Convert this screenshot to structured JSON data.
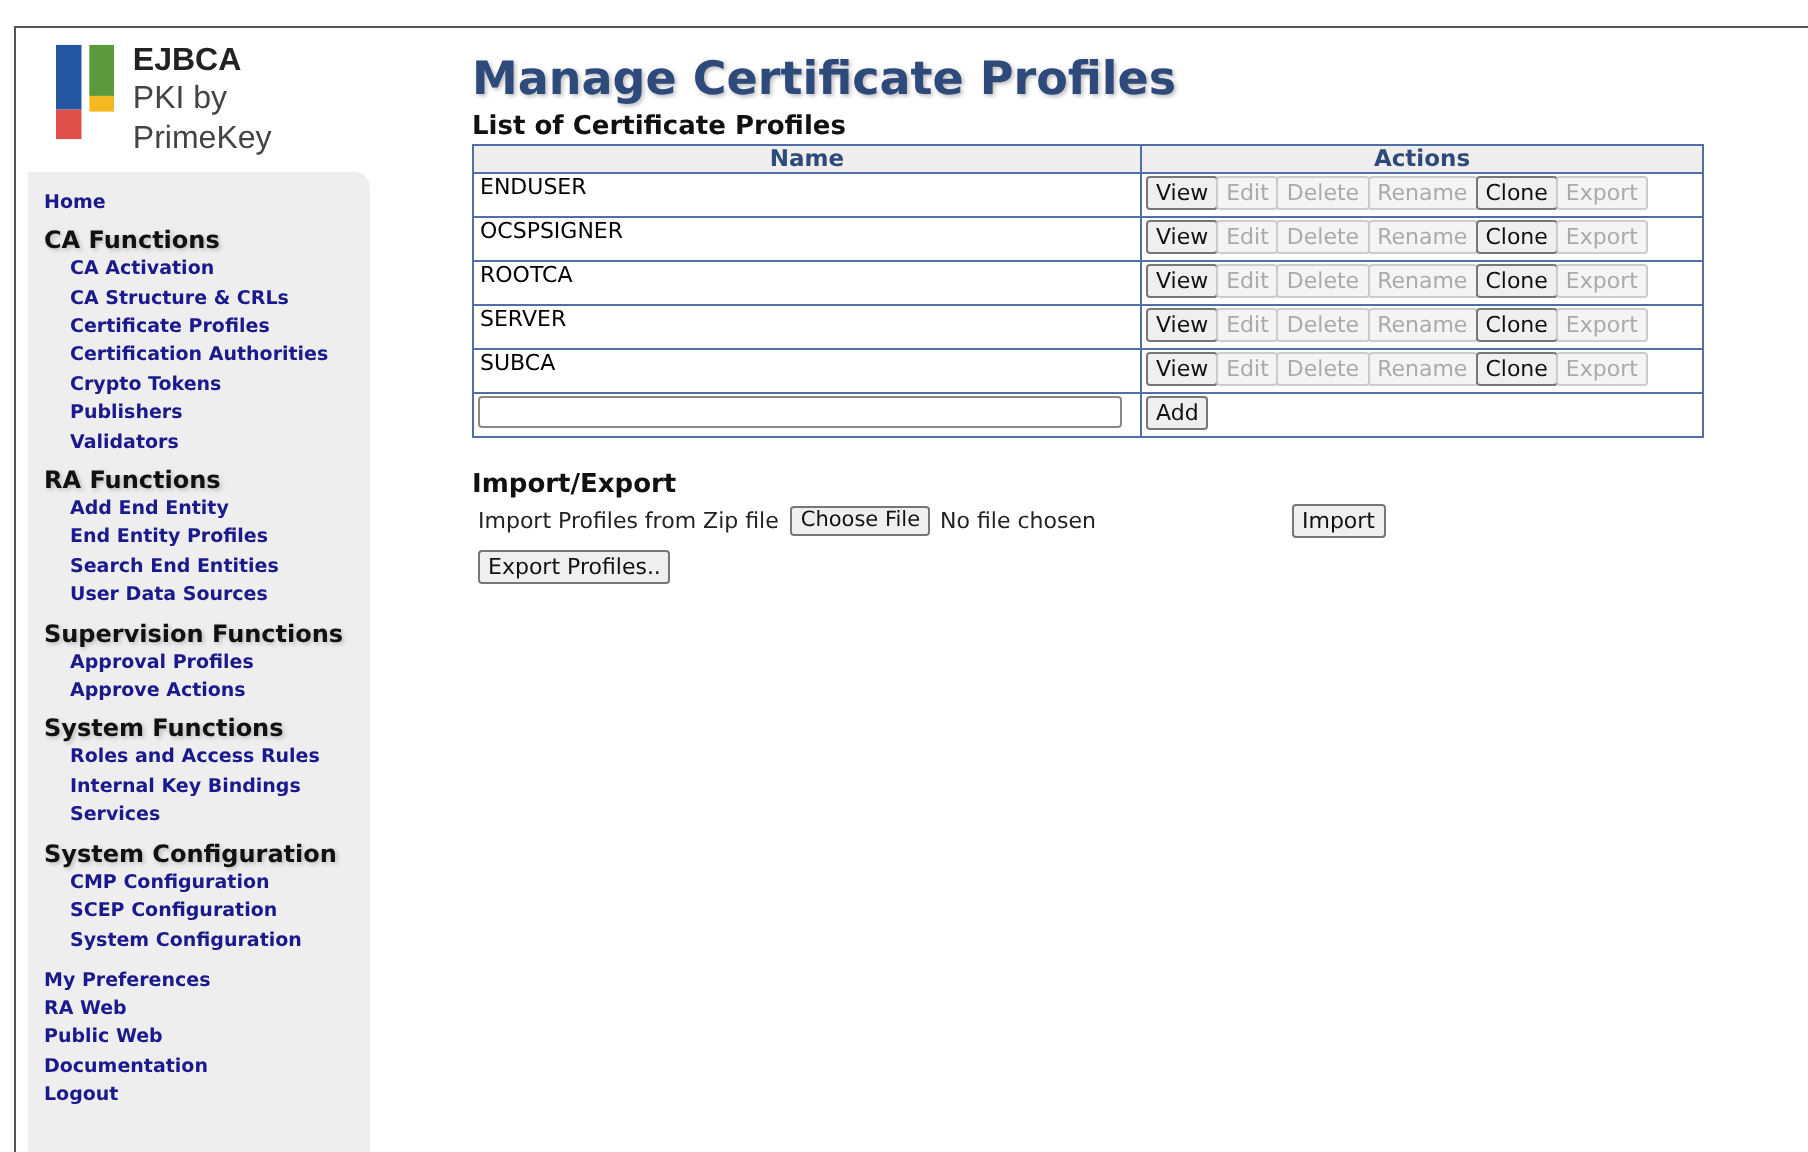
{
  "logo": {
    "title": "EJBCA",
    "subtitle": "PKI by PrimeKey"
  },
  "sidebar": {
    "top": [
      {
        "label": "Home"
      }
    ],
    "sections": [
      {
        "heading": "CA Functions",
        "items": [
          {
            "label": "CA Activation"
          },
          {
            "label": "CA Structure & CRLs"
          },
          {
            "label": "Certificate Profiles"
          },
          {
            "label": "Certification Authorities"
          },
          {
            "label": "Crypto Tokens"
          },
          {
            "label": "Publishers"
          },
          {
            "label": "Validators"
          }
        ]
      },
      {
        "heading": "RA Functions",
        "items": [
          {
            "label": "Add End Entity"
          },
          {
            "label": "End Entity Profiles"
          },
          {
            "label": "Search End Entities"
          },
          {
            "label": "User Data Sources"
          }
        ]
      },
      {
        "heading": "Supervision Functions",
        "items": [
          {
            "label": "Approval Profiles"
          },
          {
            "label": "Approve Actions"
          }
        ]
      },
      {
        "heading": "System Functions",
        "items": [
          {
            "label": "Roles and Access Rules"
          },
          {
            "label": "Internal Key Bindings"
          },
          {
            "label": "Services"
          }
        ]
      },
      {
        "heading": "System Configuration",
        "items": [
          {
            "label": "CMP Configuration"
          },
          {
            "label": "SCEP Configuration"
          },
          {
            "label": "System Configuration"
          }
        ]
      }
    ],
    "bottom": [
      {
        "label": "My Preferences"
      },
      {
        "label": "RA Web"
      },
      {
        "label": "Public Web"
      },
      {
        "label": "Documentation"
      },
      {
        "label": "Logout"
      }
    ]
  },
  "page_title": "Manage Certificate Profiles",
  "table": {
    "title": "List of Certificate Profiles",
    "columns": [
      "Name",
      "Actions"
    ],
    "rows": [
      {
        "name": "ENDUSER",
        "actions": [
          {
            "label": "View",
            "disabled": false
          },
          {
            "label": "Edit",
            "disabled": true
          },
          {
            "label": "Delete",
            "disabled": true
          },
          {
            "label": "Rename",
            "disabled": true
          },
          {
            "label": "Clone",
            "disabled": false
          },
          {
            "label": "Export",
            "disabled": true
          }
        ]
      },
      {
        "name": "OCSPSIGNER",
        "actions": [
          {
            "label": "View",
            "disabled": false
          },
          {
            "label": "Edit",
            "disabled": true
          },
          {
            "label": "Delete",
            "disabled": true
          },
          {
            "label": "Rename",
            "disabled": true
          },
          {
            "label": "Clone",
            "disabled": false
          },
          {
            "label": "Export",
            "disabled": true
          }
        ]
      },
      {
        "name": "ROOTCA",
        "actions": [
          {
            "label": "View",
            "disabled": false
          },
          {
            "label": "Edit",
            "disabled": true
          },
          {
            "label": "Delete",
            "disabled": true
          },
          {
            "label": "Rename",
            "disabled": true
          },
          {
            "label": "Clone",
            "disabled": false
          },
          {
            "label": "Export",
            "disabled": true
          }
        ]
      },
      {
        "name": "SERVER",
        "actions": [
          {
            "label": "View",
            "disabled": false
          },
          {
            "label": "Edit",
            "disabled": true
          },
          {
            "label": "Delete",
            "disabled": true
          },
          {
            "label": "Rename",
            "disabled": true
          },
          {
            "label": "Clone",
            "disabled": false
          },
          {
            "label": "Export",
            "disabled": true
          }
        ]
      },
      {
        "name": "SUBCA",
        "actions": [
          {
            "label": "View",
            "disabled": false
          },
          {
            "label": "Edit",
            "disabled": true
          },
          {
            "label": "Delete",
            "disabled": true
          },
          {
            "label": "Rename",
            "disabled": true
          },
          {
            "label": "Clone",
            "disabled": false
          },
          {
            "label": "Export",
            "disabled": true
          }
        ]
      }
    ],
    "add_button": "Add"
  },
  "import_export": {
    "title": "Import/Export",
    "import_label": "Import Profiles from Zip file",
    "choose_file": "Choose File",
    "file_status": "No file chosen",
    "import_button": "Import",
    "export_button": "Export Profiles.."
  }
}
